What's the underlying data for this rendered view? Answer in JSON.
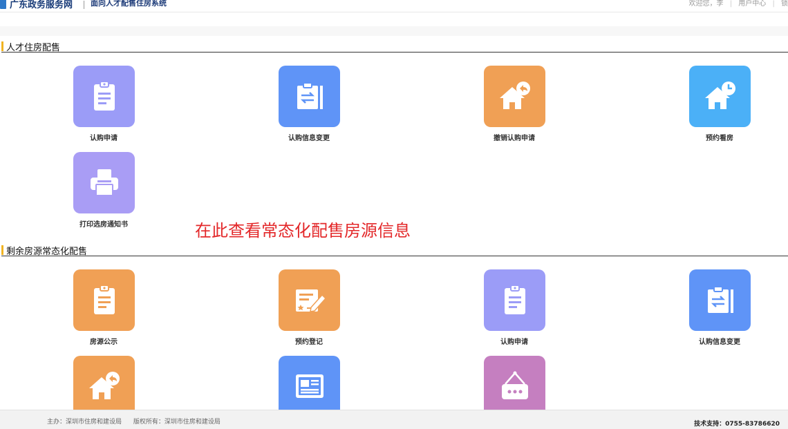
{
  "header": {
    "site_name": "广东政务服务网",
    "system_name": "面向人才配售住房系统",
    "welcome": "欢迎您，李",
    "user_center": "用户中心",
    "extra": "锁"
  },
  "sections": [
    {
      "title": "人才住房配售",
      "tiles": [
        {
          "label": "认购申请",
          "icon": "clipboard-icon",
          "color": "#9b9cf7"
        },
        {
          "label": "认购信息变更",
          "icon": "transfer-doc-icon",
          "color": "#5f94f7"
        },
        {
          "label": "撤销认购申请",
          "icon": "house-undo-icon",
          "color": "#f0a055"
        },
        {
          "label": "预约看房",
          "icon": "house-clock-icon",
          "color": "#4bb0f7"
        },
        {
          "label": "打印选房通知书",
          "icon": "printer-icon",
          "color": "#a99df5"
        }
      ]
    },
    {
      "title": "剩余房源常态化配售",
      "tiles": [
        {
          "label": "房源公示",
          "icon": "clipboard-icon",
          "color": "#f0a055"
        },
        {
          "label": "预约登记",
          "icon": "form-pen-icon",
          "color": "#f0a055"
        },
        {
          "label": "认购申请",
          "icon": "clipboard-icon",
          "color": "#9b9cf7"
        },
        {
          "label": "认购信息变更",
          "icon": "transfer-doc-icon",
          "color": "#5f94f7"
        },
        {
          "label": "",
          "icon": "house-undo-icon",
          "color": "#f0a055"
        },
        {
          "label": "",
          "icon": "newspaper-icon",
          "color": "#5f94f7"
        },
        {
          "label": "",
          "icon": "hanging-sign-icon",
          "color": "#c57fc0"
        }
      ]
    }
  ],
  "notice": "在此查看常态化配售房源信息",
  "footer": {
    "host": "主办：深圳市住房和建设局",
    "copyright": "版权所有：深圳市住房和建设局",
    "support": "技术支持：0755-83786620"
  }
}
